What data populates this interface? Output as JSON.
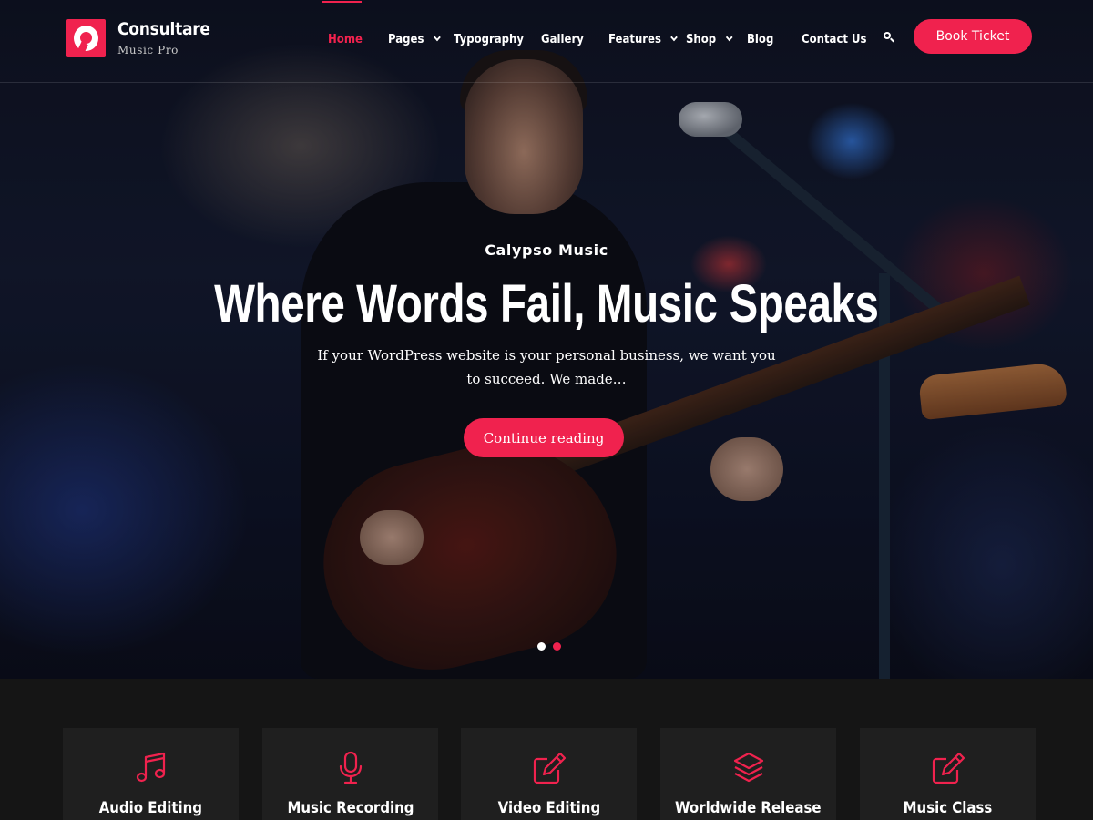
{
  "site": {
    "name": "Consultare",
    "tagline": "Music Pro"
  },
  "nav": {
    "items": [
      {
        "label": "Home",
        "active": true,
        "dropdown": false
      },
      {
        "label": "Pages",
        "active": false,
        "dropdown": true
      },
      {
        "label": "Typography",
        "active": false,
        "dropdown": false
      },
      {
        "label": "Gallery",
        "active": false,
        "dropdown": false
      },
      {
        "label": "Features",
        "active": false,
        "dropdown": true
      },
      {
        "label": "Shop",
        "active": false,
        "dropdown": true
      },
      {
        "label": "Blog",
        "active": false,
        "dropdown": false
      },
      {
        "label": "Contact Us",
        "active": false,
        "dropdown": false
      }
    ],
    "search_icon": "search-icon",
    "cta_label": "Book Ticket"
  },
  "hero": {
    "kicker": "Calypso Music",
    "headline": "Where Words Fail, Music Speaks",
    "excerpt": "If your WordPress website is your personal business, we want you to succeed. We made…",
    "button_label": "Continue reading",
    "slides": 2,
    "active_slide": 2
  },
  "services": [
    {
      "label": "Audio Editing",
      "icon": "music-note-icon"
    },
    {
      "label": "Music Recording",
      "icon": "microphone-icon"
    },
    {
      "label": "Video Editing",
      "icon": "edit-icon"
    },
    {
      "label": "Worldwide Release",
      "icon": "layers-icon"
    },
    {
      "label": "Music Class",
      "icon": "edit-icon"
    }
  ],
  "colors": {
    "accent": "#f0224e",
    "background": "#151515",
    "card": "#1f1f1f"
  }
}
